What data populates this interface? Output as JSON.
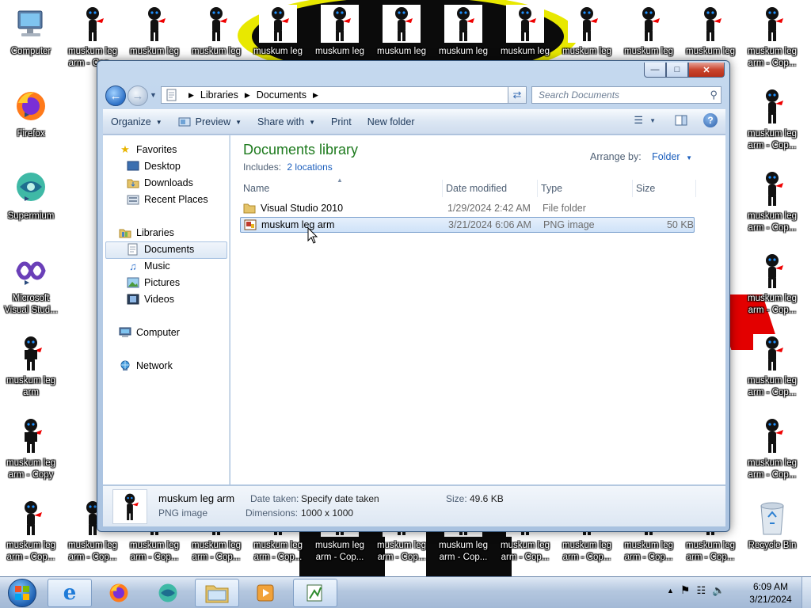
{
  "desktop": {
    "icons": [
      {
        "label": "Computer",
        "icon": "computer-icon"
      },
      {
        "label": "Firefox",
        "icon": "firefox-icon"
      },
      {
        "label": "Supermium",
        "icon": "supermium-icon"
      },
      {
        "label": "Microsoft Visual Stud...",
        "icon": "visual-studio-icon"
      },
      {
        "label": "muskum leg arm",
        "icon": "stickman-image-icon"
      },
      {
        "label": "muskum leg arm - Copy",
        "icon": "stickman-image-icon"
      },
      {
        "label": "muskum leg arm - Cop...",
        "icon": "stickman-image-icon"
      },
      {
        "label": "muskum leg",
        "icon": "stickman-image-icon"
      },
      {
        "label": "Recycle Bin",
        "icon": "recycle-bin-icon"
      }
    ]
  },
  "window": {
    "caption_buttons": [
      "minimize",
      "maximize",
      "close"
    ],
    "address": [
      "Libraries",
      "Documents"
    ],
    "search_placeholder": "Search Documents",
    "toolbar": {
      "organize": "Organize",
      "preview": "Preview",
      "share_with": "Share with",
      "print": "Print",
      "new_folder": "New folder"
    },
    "nav": {
      "favorites": "Favorites",
      "desktop": "Desktop",
      "downloads": "Downloads",
      "recent_places": "Recent Places",
      "libraries": "Libraries",
      "documents": "Documents",
      "music": "Music",
      "pictures": "Pictures",
      "videos": "Videos",
      "computer": "Computer",
      "network": "Network"
    },
    "library": {
      "title": "Documents library",
      "includes_label": "Includes:",
      "includes_link": "2 locations",
      "arrange_label": "Arrange by:",
      "arrange_value": "Folder"
    },
    "columns": [
      "Name",
      "Date modified",
      "Type",
      "Size"
    ],
    "rows": [
      {
        "name": "Visual Studio 2010",
        "date": "1/29/2024 2:42 AM",
        "type": "File folder",
        "size": ""
      },
      {
        "name": "muskum leg arm",
        "date": "3/21/2024 6:06 AM",
        "type": "PNG image",
        "size": "50 KB"
      }
    ],
    "details": {
      "name": "muskum leg arm",
      "type": "PNG image",
      "date_taken_label": "Date taken:",
      "date_taken_value": "Specify date taken",
      "dimensions_label": "Dimensions:",
      "dimensions_value": "1000 x 1000",
      "size_label": "Size:",
      "size_value": "49.6 KB"
    }
  },
  "taskbar": {
    "apps": [
      "internet-explorer-icon",
      "firefox-icon",
      "supermium-icon",
      "windows-explorer-icon",
      "media-player-icon",
      "paint-icon"
    ],
    "clock_time": "6:09 AM",
    "clock_date": "3/21/2024"
  }
}
